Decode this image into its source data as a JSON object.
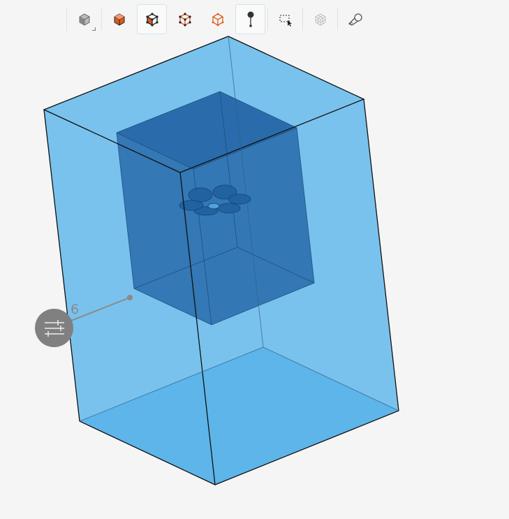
{
  "toolbar": {
    "buttons": [
      {
        "icon": "view-cube-icon",
        "active": false
      },
      {
        "icon": "solid-body-icon",
        "active": false
      },
      {
        "icon": "face-select-icon",
        "active": true
      },
      {
        "icon": "edge-select-icon",
        "active": false
      },
      {
        "icon": "vertex-select-icon",
        "active": false
      },
      {
        "icon": "point-probe-icon",
        "active": true
      },
      {
        "icon": "box-select-icon",
        "active": false
      },
      {
        "icon": "mesh-icon",
        "active": false
      },
      {
        "icon": "measure-tape-icon",
        "active": false
      }
    ]
  },
  "scene": {
    "outer_color": "#6cbcec",
    "inner_color": "#2f72b0",
    "dimension_label": "6"
  }
}
